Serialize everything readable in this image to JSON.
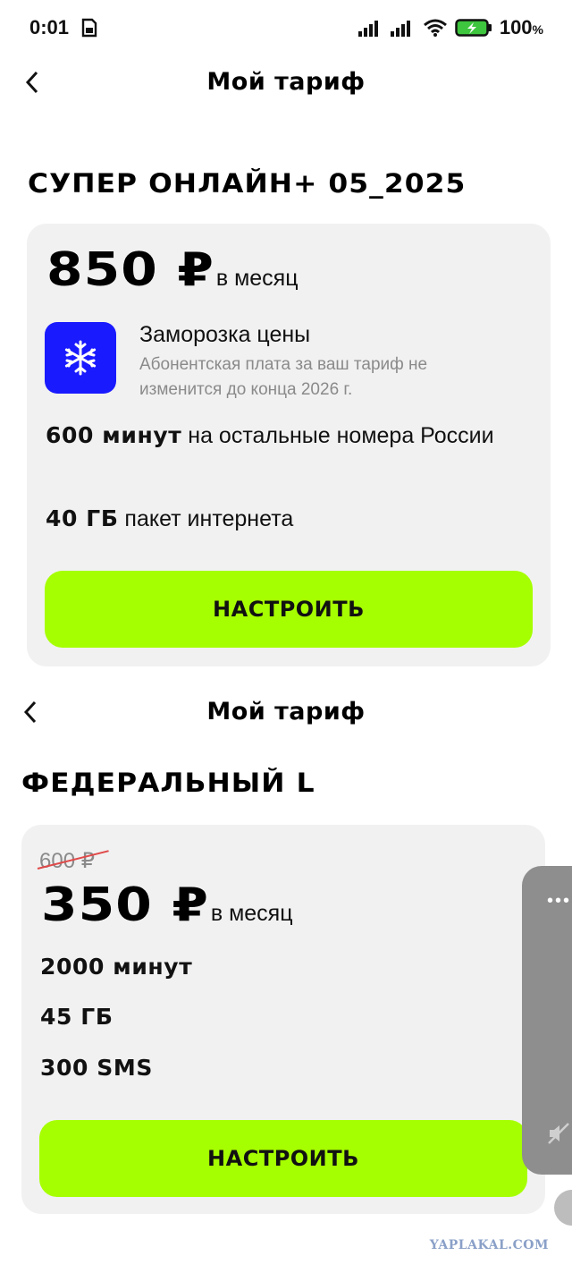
{
  "status_bar": {
    "time": "0:01",
    "battery": "100",
    "battery_unit": "%"
  },
  "screen1": {
    "title": "Мой тариф",
    "tariff_name": "СУПЕР ОНЛАЙН+ 05_2025",
    "price": "850 ₽",
    "per_month": "в месяц",
    "freeze": {
      "icon": "snowflake-icon",
      "title": "Заморозка цены",
      "description": "Абонентская плата за ваш тариф не изменится до конца 2026 г."
    },
    "features": [
      {
        "bold": "600 минут",
        "text": " на остальные номера России"
      },
      {
        "bold": "40 ГБ",
        "text": " пакет интернета"
      }
    ],
    "button": "НАСТРОИТЬ"
  },
  "screen2": {
    "title": "Мой тариф",
    "tariff_name": "ФЕДЕРАЛЬНЫЙ L",
    "old_price": "600 ₽",
    "price": "350 ₽",
    "per_month": "в месяц",
    "features": [
      "2000 минут",
      "45 ГБ",
      "300 SMS"
    ],
    "button": "НАСТРОИТЬ"
  },
  "side_panel": {
    "dots": "•••"
  },
  "watermark": "YAPLAKAL.COM",
  "colors": {
    "accent": "#a6ff00",
    "freeze_icon_bg": "#1a1aff",
    "card_bg": "#f1f1f1",
    "strike": "#e04a4a"
  }
}
